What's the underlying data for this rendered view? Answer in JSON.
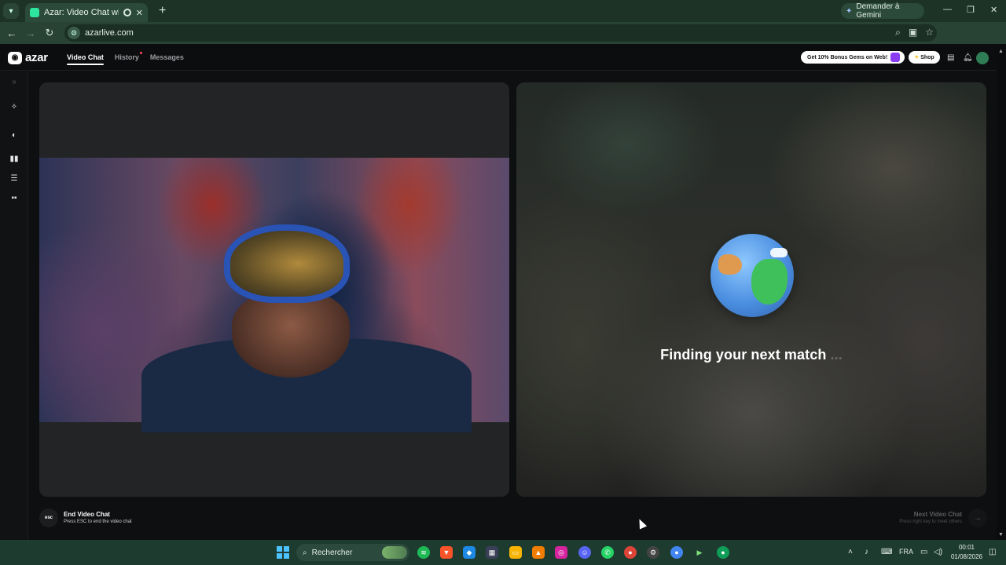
{
  "browser": {
    "tab_title": "Azar: Video Chat with New",
    "url": "azarlive.com",
    "gemini_label": "Demander à Gemini"
  },
  "app": {
    "logo_text": "azar",
    "nav": {
      "video_chat": "Video Chat",
      "history": "History",
      "messages": "Messages"
    },
    "promo_text": "Get 10% Bonus Gems on Web!",
    "shop_label": "Shop"
  },
  "match": {
    "status_text": "Finding your next match",
    "status_dots": "..."
  },
  "footer": {
    "esc_key": "esc",
    "end_title": "End Video Chat",
    "end_sub": "Press ESC to end the video chat",
    "next_title": "Next Video Chat",
    "next_sub": "Press right key to meet others"
  },
  "taskbar": {
    "search_placeholder": "Rechercher",
    "language": "FRA",
    "time": "00:01",
    "date": "01/08/2026"
  },
  "colors": {
    "browser_frame": "#1c3326",
    "accent_green": "#2ee59d",
    "notification_dot": "#ff4a62",
    "app_background": "#0e0f10"
  }
}
